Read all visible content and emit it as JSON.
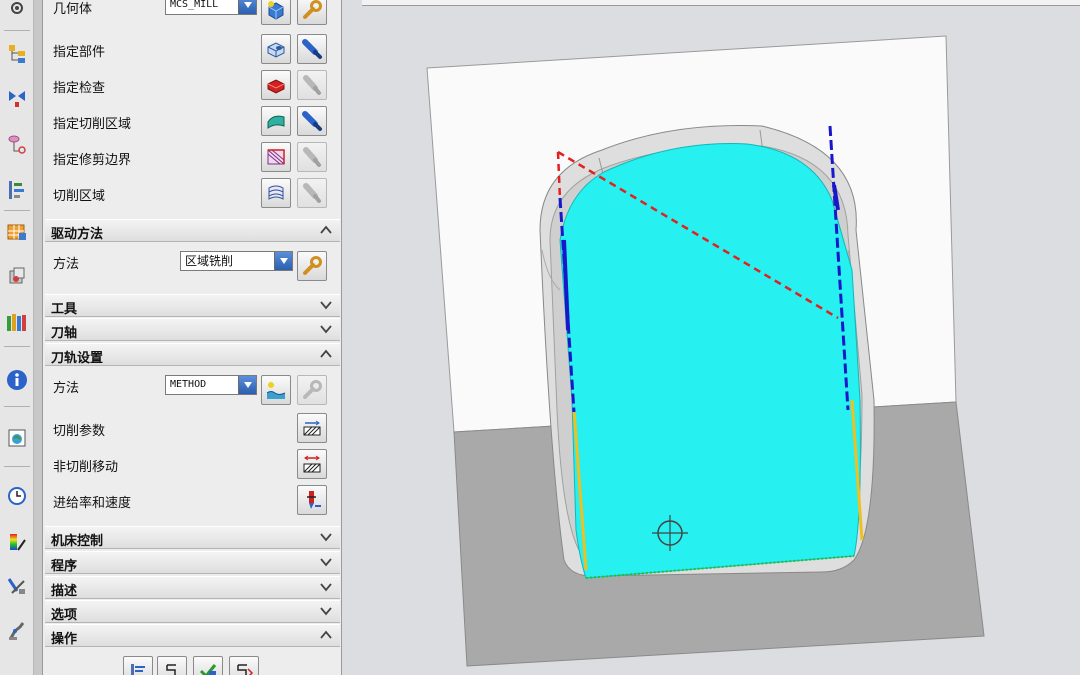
{
  "panel": {
    "geometry": {
      "label": "几何体",
      "value": "MCS_MILL"
    },
    "rows": [
      {
        "label": "指定部件"
      },
      {
        "label": "指定检查"
      },
      {
        "label": "指定切削区域"
      },
      {
        "label": "指定修剪边界"
      },
      {
        "label": "切削区域"
      }
    ],
    "drive_method": {
      "title": "驱动方法",
      "method_label": "方法",
      "method_value": "区域铣削"
    },
    "collapsed_sections_1": [
      "工具",
      "刀轴"
    ],
    "toolpath_settings": {
      "title": "刀轨设置",
      "method_label": "方法",
      "method_value": "METHOD",
      "rows": [
        {
          "label": "切削参数"
        },
        {
          "label": "非切削移动"
        },
        {
          "label": "进给率和速度"
        }
      ]
    },
    "collapsed_sections_2": [
      "机床控制",
      "程序",
      "描述",
      "选项"
    ],
    "operation": {
      "title": "操作"
    }
  },
  "colors": {
    "cut_region": "#26f0f0",
    "dashed_red": "#e22020",
    "dashed_blue": "#1818c8",
    "yellow_edge": "#f0c020"
  },
  "icons": {
    "left_toolbar": [
      "gear-icon",
      "program-order-view-icon",
      "machine-tool-view-icon",
      "geometry-view-icon",
      "machining-method-view-icon",
      "operation-navigator-icon",
      "part-navigator-icon",
      "library-icon",
      "info-icon",
      "web-browser-icon",
      "history-icon",
      "analysis-icon",
      "simulation-icon",
      "robot-icon"
    ]
  }
}
